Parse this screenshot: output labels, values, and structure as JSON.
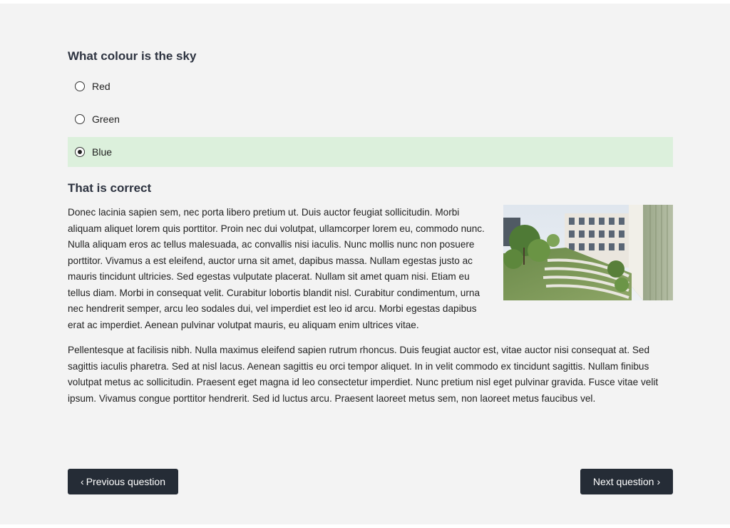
{
  "question": {
    "title": "What colour is the sky",
    "options": [
      {
        "label": "Red",
        "selected": false
      },
      {
        "label": "Green",
        "selected": false
      },
      {
        "label": "Blue",
        "selected": true
      }
    ]
  },
  "feedback": {
    "title": "That is correct",
    "paragraphs": [
      "Donec lacinia sapien sem, nec porta libero pretium ut. Duis auctor feugiat sollicitudin. Morbi aliquam aliquet lorem quis porttitor. Proin nec dui volutpat, ullamcorper lorem eu, commodo nunc. Nulla aliquam eros ac tellus malesuada, ac convallis nisi iaculis. Nunc mollis nunc non posuere porttitor. Vivamus a est eleifend, auctor urna sit amet, dapibus massa. Nullam egestas justo ac mauris tincidunt ultricies. Sed egestas vulputate placerat. Nullam sit amet quam nisi. Etiam eu tellus diam. Morbi in consequat velit. Curabitur lobortis blandit nisl. Curabitur condimentum, urna nec hendrerit semper, arcu leo sodales dui, vel imperdiet est leo id arcu. Morbi egestas dapibus erat ac imperdiet. Aenean pulvinar volutpat mauris, eu aliquam enim ultrices vitae.",
      "Pellentesque at facilisis nibh. Nulla maximus eleifend sapien rutrum rhoncus. Duis feugiat auctor est, vitae auctor nisi consequat at. Sed sagittis iaculis pharetra. Sed at nisl lacus. Aenean sagittis eu orci tempor aliquet. In in velit commodo ex tincidunt sagittis. Nullam finibus volutpat metus ac sollicitudin. Praesent eget magna id leo consectetur imperdiet. Nunc pretium nisl eget pulvinar gravida. Fusce vitae velit ipsum. Vivamus congue porttitor hendrerit. Sed id luctus arcu. Praesent laoreet metus sem, non laoreet metus faucibus vel."
    ]
  },
  "navigation": {
    "prev_label": "Previous question",
    "next_label": "Next question",
    "prev_icon": "chevron-left-icon",
    "next_icon": "chevron-right-icon"
  },
  "colors": {
    "page_background": "#f3f3f3",
    "selected_option_background": "#dcf0dc",
    "button_background": "#252c36",
    "heading_text": "#2d3340"
  }
}
